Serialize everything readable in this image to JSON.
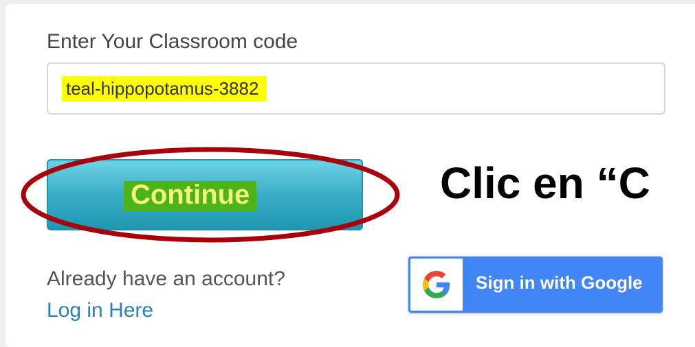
{
  "form": {
    "code_label": "Enter Your Classroom code",
    "code_value": "teal-hippopotamus-3882",
    "continue_label": "Continue",
    "already_text": "Already have an account?",
    "login_link": "Log in Here",
    "google_label": "Sign in with Google"
  },
  "annotation": {
    "text": "Clic en “C"
  },
  "icons": {
    "google": "google-g-icon"
  },
  "colors": {
    "input_highlight": "#ffff00",
    "continue_label_highlight": "#4db31a",
    "continue_text": "#f4f47a",
    "continue_button": "#39aec7",
    "annotation_ellipse": "#a8000a",
    "google_button": "#4285f4",
    "link": "#2b7fb6"
  }
}
